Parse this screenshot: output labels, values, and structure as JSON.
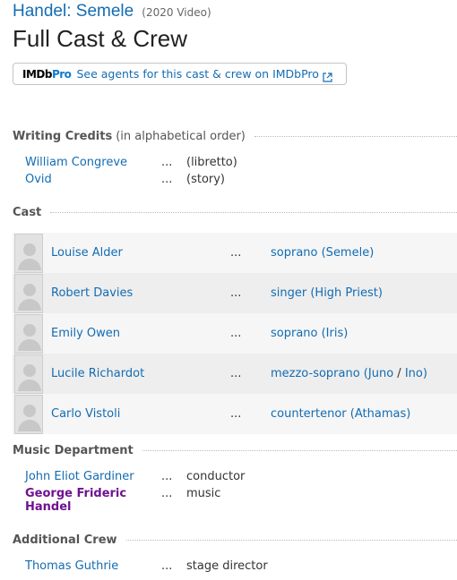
{
  "title": {
    "link": "Handel: Semele",
    "year": "(2020 Video)"
  },
  "page_heading": "Full Cast & Crew",
  "pro_banner": {
    "logo_imdb": "IMDb",
    "logo_pro": "Pro",
    "text": "See agents for this cast & crew on IMDbPro",
    "icon": "external-link-icon"
  },
  "writing": {
    "label": "Writing Credits",
    "sub": "(in alphabetical order)",
    "rows": [
      {
        "name": "William Congreve",
        "dots": "...",
        "role": "(libretto)"
      },
      {
        "name": "Ovid",
        "dots": "...",
        "role": "(story)"
      }
    ]
  },
  "cast": {
    "label": "Cast",
    "rows": [
      {
        "name": "Louise Alder",
        "dots": "...",
        "character": "soprano (Semele)"
      },
      {
        "name": "Robert Davies",
        "dots": "...",
        "character": "singer (High Priest)"
      },
      {
        "name": "Emily Owen",
        "dots": "...",
        "character": "soprano (Iris)"
      },
      {
        "name": "Lucile Richardot",
        "dots": "...",
        "character_a": "mezzo-soprano (Juno",
        "character_sep": " / ",
        "character_b": "Ino)"
      },
      {
        "name": "Carlo Vistoli",
        "dots": "...",
        "character": "countertenor (Athamas)"
      }
    ]
  },
  "music": {
    "label": "Music Department",
    "rows": [
      {
        "name": "John Eliot Gardiner",
        "dots": "...",
        "role": "conductor"
      },
      {
        "name_line1": "George Frideric",
        "name_line2": "Handel",
        "dots": "...",
        "role": "music"
      }
    ]
  },
  "additional": {
    "label": "Additional Crew",
    "rows": [
      {
        "name": "Thomas Guthrie",
        "dots": "...",
        "role": "stage director"
      }
    ]
  },
  "colors": {
    "link": "#136cb2",
    "visited": "#70118f",
    "pro_blue": "#0d7bcc"
  }
}
